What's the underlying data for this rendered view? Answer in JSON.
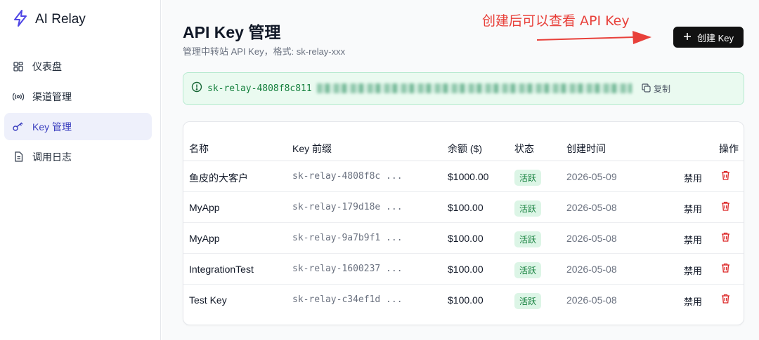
{
  "sidebar": {
    "brand": "AI Relay",
    "items": [
      {
        "label": "仪表盘",
        "icon": "dashboard-grid-icon"
      },
      {
        "label": "渠道管理",
        "icon": "radio-broadcast-icon"
      },
      {
        "label": "Key 管理",
        "icon": "key-icon",
        "active": true
      },
      {
        "label": "调用日志",
        "icon": "document-icon"
      }
    ]
  },
  "header": {
    "title": "API Key 管理",
    "subtitle": "管理中转站 API Key，格式: sk-relay-xxx",
    "annotation": "创建后可以查看 API Key",
    "create_button": "创建 Key"
  },
  "new_key_banner": {
    "key_visible_part": "sk-relay-4808f8c811",
    "copy_label": "复制"
  },
  "table": {
    "headers": {
      "name": "名称",
      "prefix": "Key 前缀",
      "balance": "余额 ($)",
      "status": "状态",
      "created": "创建时间",
      "actions": "操作"
    },
    "rows": [
      {
        "name": "鱼皮的大客户",
        "prefix": "sk-relay-4808f8c ...",
        "balance": "$1000.00",
        "status": "活跃",
        "created": "2026-05-09",
        "disable": "禁用"
      },
      {
        "name": "MyApp",
        "prefix": "sk-relay-179d18e ...",
        "balance": "$100.00",
        "status": "活跃",
        "created": "2026-05-08",
        "disable": "禁用"
      },
      {
        "name": "MyApp",
        "prefix": "sk-relay-9a7b9f1 ...",
        "balance": "$100.00",
        "status": "活跃",
        "created": "2026-05-08",
        "disable": "禁用"
      },
      {
        "name": "IntegrationTest",
        "prefix": "sk-relay-1600237 ...",
        "balance": "$100.00",
        "status": "活跃",
        "created": "2026-05-08",
        "disable": "禁用"
      },
      {
        "name": "Test Key",
        "prefix": "sk-relay-c34ef1d ...",
        "balance": "$100.00",
        "status": "活跃",
        "created": "2026-05-08",
        "disable": "禁用"
      }
    ]
  },
  "colors": {
    "accent": "#3b3fbf",
    "active_nav_bg": "#eef0fb",
    "success_bg": "#dcf5e6",
    "success_text": "#15803d",
    "danger": "#dc2626",
    "annotation": "#e8403a"
  }
}
